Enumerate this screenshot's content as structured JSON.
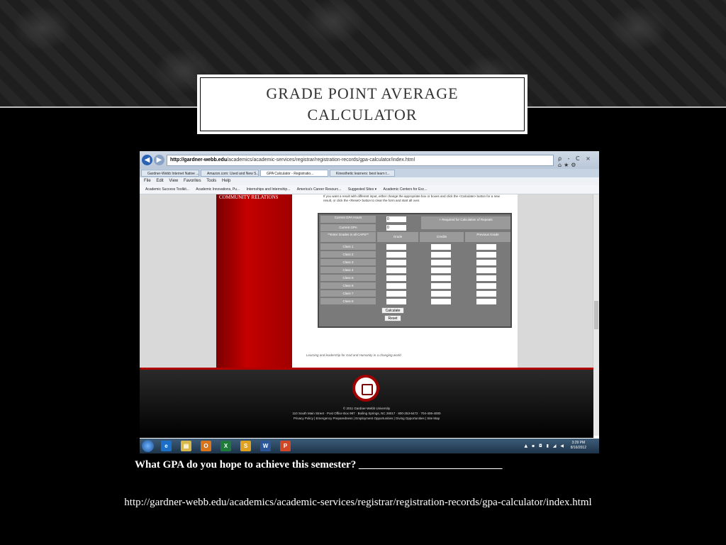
{
  "slide": {
    "title": "GRADE POINT AVERAGE CALCULATOR",
    "question": "What GPA do you hope to achieve this semester? ___________________________",
    "url": "http://gardner-webb.edu/academics/academic-services/registrar/registration-records/gpa-calculator/index.html"
  },
  "browser": {
    "address_host": "http://gardner-webb.edu",
    "address_path": "/academics/academic-services/registrar/registration-records/gpa-calculator/index.html",
    "search_hint": "ρ - C ×",
    "tabs": [
      "Gardner-Webb Internet Native ...",
      "Amazon.com: Used and New S...",
      "GPA Calculator - Registratio...",
      "Kinesthetic learners: best learn t..."
    ],
    "menu": [
      "File",
      "Edit",
      "View",
      "Favorites",
      "Tools",
      "Help"
    ],
    "favorites": [
      "Academic Success Toolkit...",
      "Academic Innovations, Pu...",
      "Internships and Internship...",
      "America's Career Resourc...",
      "Suggested Sites ▾",
      "Academic Centers for Exc..."
    ]
  },
  "page": {
    "side_heading": "COMMUNITY RELATIONS",
    "intro": "If you want a result with different input, either change the appropriate box or boxes and click the <Calculate> button for a new result, or click the <Reset> button to clear the form and start all over.",
    "current_gpa_hours_label": "Current GPA Hours",
    "current_gpa_label": "Current GPA",
    "current_gpa_hours_value": "0",
    "current_gpa_value": "0",
    "required_note": "+ Required for Calculation of Repeats",
    "enter_grades_label": "**Enter Grades in all CAPS**",
    "col_grade": "Grade",
    "col_credits": "Credits",
    "col_previous": "Previous Grade",
    "classes": [
      "Class 1",
      "Class 2",
      "Class 3",
      "Class 4",
      "Class 5",
      "Class 6",
      "Class 7",
      "Class 8"
    ],
    "calculate_label": "Calculate",
    "reset_label": "Reset",
    "motto": "Learning and leadership for God and Humanity in a changing world",
    "footer_copyright": "© 2011 Gardner-Webb University",
    "footer_address": "110 South Main Street · Post Office Box 997 · Boiling Springs, NC 28017 · 800-253-6472 · 704-406-4000",
    "footer_links": "Privacy Policy | Emergency Preparedness | Employment Opportunities | Giving Opportunities | Site Map"
  },
  "taskbar": {
    "time": "3:29 PM",
    "date": "8/16/2012"
  }
}
